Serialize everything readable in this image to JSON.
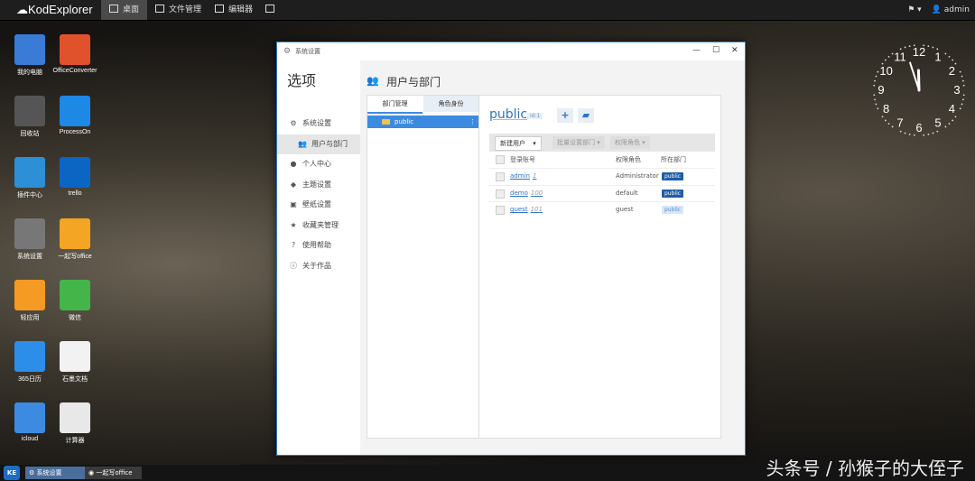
{
  "topbar": {
    "logo": "KodExplorer",
    "nav": [
      "桌面",
      "文件管理",
      "编辑器",
      ""
    ],
    "user": "admin",
    "flag_icon": "flag-icon"
  },
  "desktop": {
    "icons": [
      {
        "label": "我的电脑",
        "icon": "computer-icon",
        "color": "#3a7bd5"
      },
      {
        "label": "OfficeConverter",
        "icon": "office-converter-icon",
        "color": "#e0522b"
      },
      {
        "label": "回收站",
        "icon": "trash-icon",
        "color": "#555555"
      },
      {
        "label": "ProcessOn",
        "icon": "processon-icon",
        "color": "#1e88e5"
      },
      {
        "label": "插件中心",
        "icon": "plugin-icon",
        "color": "#2d8fd5"
      },
      {
        "label": "trello",
        "icon": "trello-icon",
        "color": "#0a66c2"
      },
      {
        "label": "系统设置",
        "icon": "settings-icon",
        "color": "#777777"
      },
      {
        "label": "一起写office",
        "icon": "yiqixie-icon",
        "color": "#f4a523"
      },
      {
        "label": "轻应用",
        "icon": "light-app-icon",
        "color": "#f59a23"
      },
      {
        "label": "微信",
        "icon": "wechat-icon",
        "color": "#44b549"
      },
      {
        "label": "365日历",
        "icon": "calendar-icon",
        "color": "#2c8ee8"
      },
      {
        "label": "石墨文档",
        "icon": "shimo-icon",
        "color": "#f2f2f2"
      },
      {
        "label": "icloud",
        "icon": "icloud-icon",
        "color": "#3d8be0"
      },
      {
        "label": "计算器",
        "icon": "calculator-icon",
        "color": "#e8e8e8"
      }
    ]
  },
  "clock": {
    "numbers": [
      "12",
      "1",
      "2",
      "3",
      "4",
      "5",
      "6",
      "7",
      "8",
      "9",
      "10",
      "11"
    ],
    "hour": 11,
    "minute": 57
  },
  "window": {
    "title": "系统设置",
    "sidebar_title": "选项",
    "sidebar_items": [
      {
        "label": "系统设置",
        "icon": "gear-icon"
      },
      {
        "label": "用户与部门",
        "icon": "users-icon",
        "active": true
      },
      {
        "label": "个人中心",
        "icon": "user-icon"
      },
      {
        "label": "主题设置",
        "icon": "palette-icon"
      },
      {
        "label": "壁纸设置",
        "icon": "image-icon"
      },
      {
        "label": "收藏夹管理",
        "icon": "star-icon"
      },
      {
        "label": "使用帮助",
        "icon": "question-icon"
      },
      {
        "label": "关于作品",
        "icon": "info-icon"
      }
    ],
    "page_title": "用户与部门",
    "tabs": [
      "部门管理",
      "角色身份"
    ],
    "tree_item": "public",
    "group_name": "public",
    "group_badge": "id:1",
    "toolbar": {
      "new_user": "新建用户",
      "batch_dept": "批量设置部门",
      "perm_role": "权限角色"
    },
    "table": {
      "headers": [
        "登录账号",
        "权限角色",
        "所在部门"
      ],
      "rows": [
        {
          "account": "admin",
          "id": "1",
          "role": "Administrator",
          "dept": "public",
          "style": "dark"
        },
        {
          "account": "demo",
          "id": "100",
          "role": "default",
          "dept": "public",
          "style": "dark"
        },
        {
          "account": "guest",
          "id": "101",
          "role": "guest",
          "dept": "public",
          "style": "light"
        }
      ]
    }
  },
  "taskbar": {
    "start": "KE",
    "tasks": [
      "系统设置",
      "一起写office"
    ]
  },
  "watermark": "头条号 / 孙猴子的大侄子"
}
